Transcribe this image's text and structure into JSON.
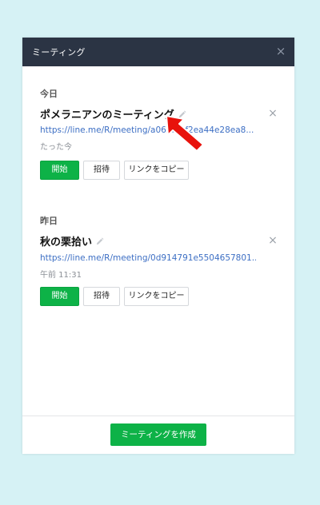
{
  "dialog": {
    "title": "ミーティング",
    "close_label": "×"
  },
  "sections": [
    {
      "label": "今日",
      "meeting": {
        "title": "ポメラニアンのミーティング",
        "url": "https://line.me/R/meeting/a06bf2ef2ea44e28ea8...",
        "time": "たった今",
        "remove_label": "×",
        "buttons": {
          "start": "開始",
          "invite": "招待",
          "copy_link": "リンクをコピー"
        }
      }
    },
    {
      "label": "昨日",
      "meeting": {
        "title": "秋の栗拾い",
        "url": "https://line.me/R/meeting/0d914791e5504657801...",
        "time": "午前 11:31",
        "remove_label": "×",
        "buttons": {
          "start": "開始",
          "invite": "招待",
          "copy_link": "リンクをコピー"
        }
      }
    }
  ],
  "footer": {
    "create_button": "ミーティングを作成"
  },
  "colors": {
    "background": "#d6f2f5",
    "titlebar": "#2b3444",
    "accent_green": "#0db247",
    "link_blue": "#3d6fc4",
    "annotation_arrow": "#e8120c"
  },
  "icons": {
    "edit": "pencil-icon",
    "close": "close-icon",
    "annotation": "red-arrow-annotation"
  }
}
